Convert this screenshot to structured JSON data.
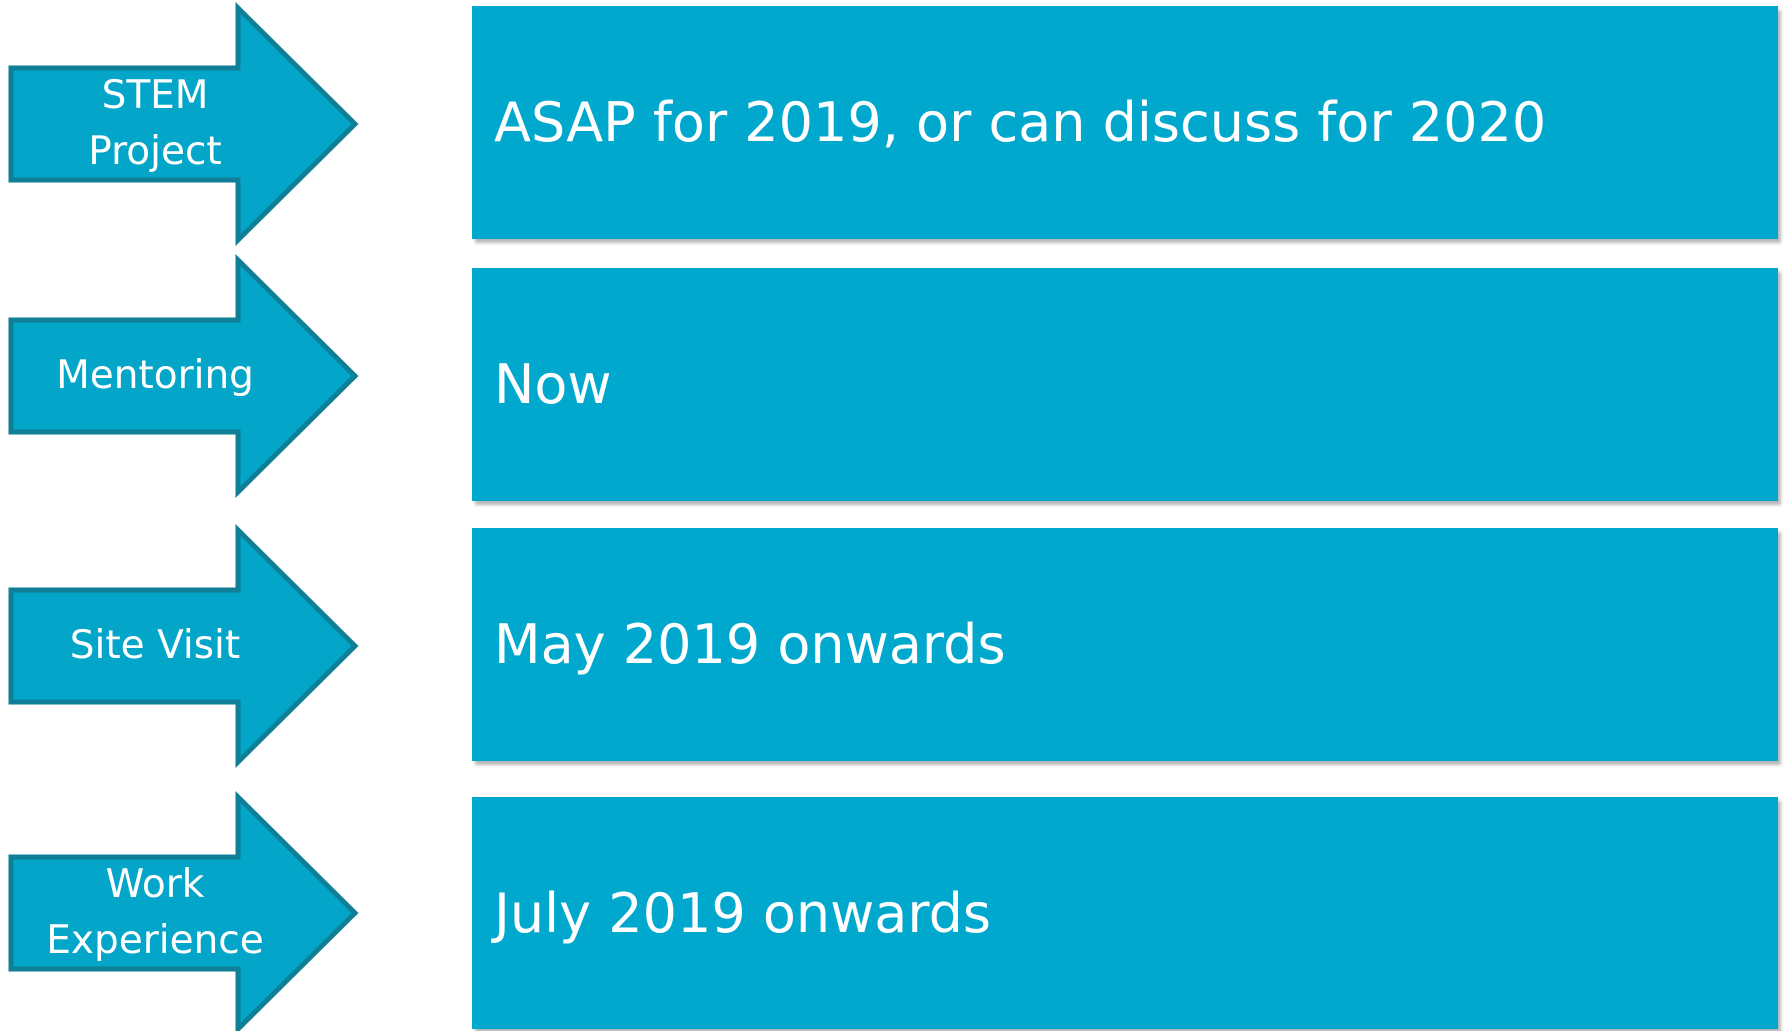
{
  "colors": {
    "fill": "#00a8ce",
    "arrow_fill": "#03a6c9",
    "arrow_stroke": "#0e7f96",
    "text": "#ffffff"
  },
  "rows": [
    {
      "stage": "STEM\nProject",
      "timing": "ASAP for 2019, or can discuss for 2020"
    },
    {
      "stage": "Mentoring",
      "timing": "Now"
    },
    {
      "stage": "Site Visit",
      "timing": "May 2019 onwards"
    },
    {
      "stage": "Work\nExperience",
      "timing": "July 2019 onwards"
    }
  ]
}
